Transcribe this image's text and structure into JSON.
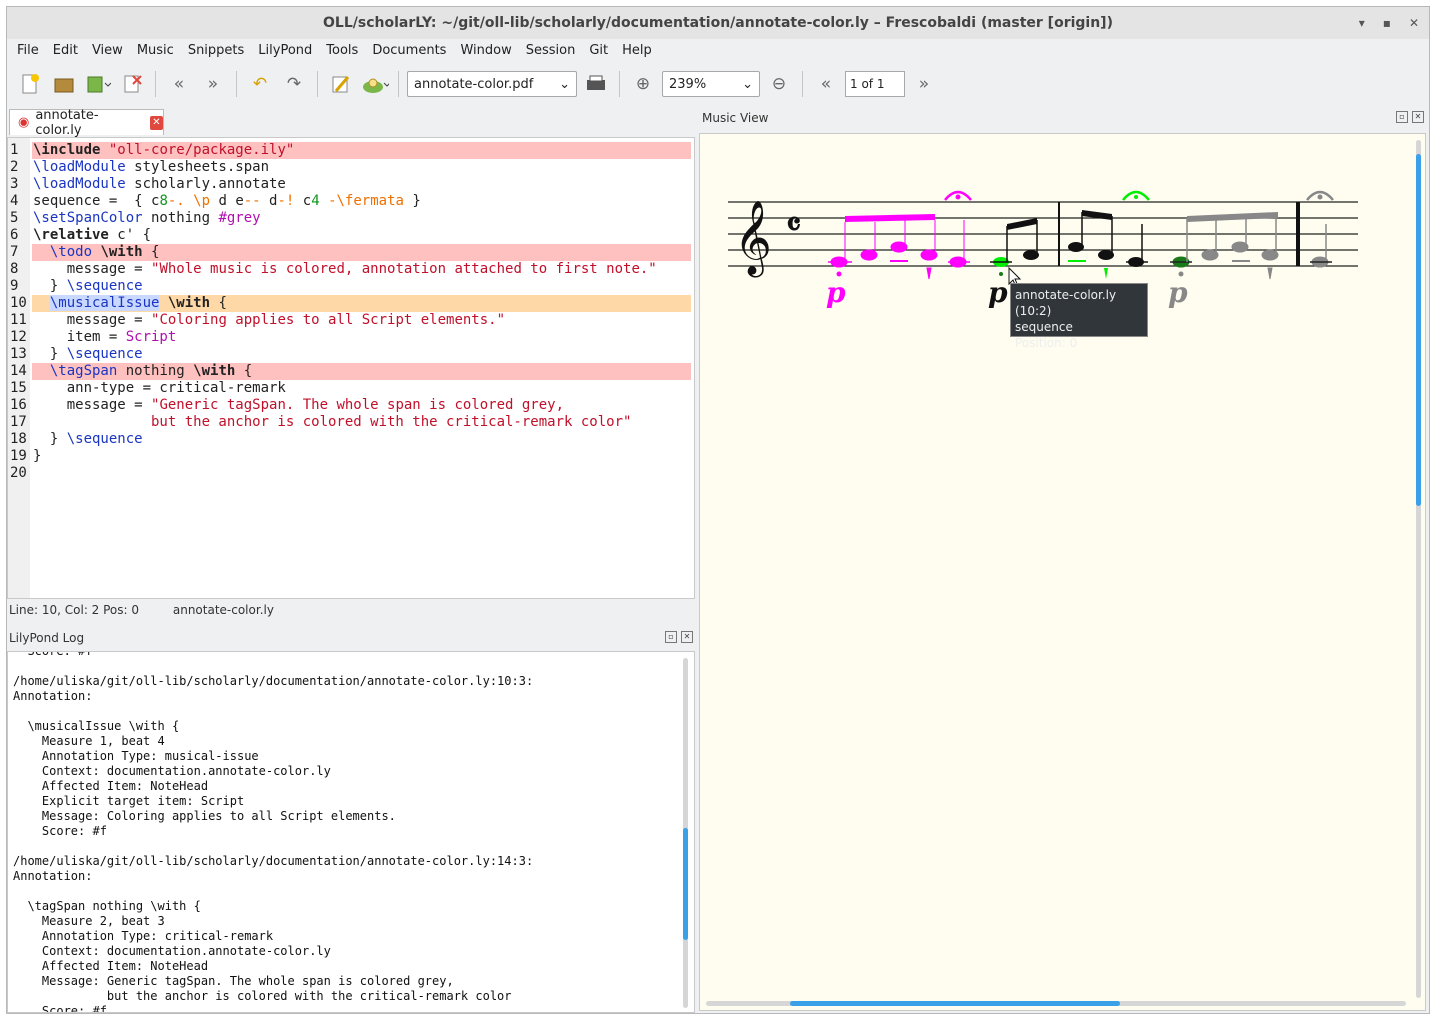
{
  "window": {
    "title": "OLL/scholarLY: ~/git/oll-lib/scholarly/documentation/annotate-color.ly – Frescobaldi (master [origin])",
    "controls": [
      "▾",
      "▪",
      "✕"
    ]
  },
  "menu": [
    "File",
    "Edit",
    "View",
    "Music",
    "Snippets",
    "LilyPond",
    "Tools",
    "Documents",
    "Window",
    "Session",
    "Git",
    "Help"
  ],
  "toolbar": {
    "document_combo": "annotate-color.pdf",
    "zoom_combo": "239%",
    "page_field": "1 of 1"
  },
  "editor": {
    "tab_label": "annotate-color.ly",
    "status": {
      "position": "Line: 10, Col: 2  Pos: 0",
      "file": "annotate-color.ly"
    },
    "line_numbers": [
      "1",
      "2",
      "3",
      "4",
      "5",
      "6",
      "7",
      "8",
      "9",
      "10",
      "11",
      "12",
      "13",
      "14",
      "15",
      "16",
      "17",
      "18",
      "19",
      "20"
    ]
  },
  "log": {
    "title": "LilyPond Log",
    "lines": [
      "  Score: #f",
      "",
      "/home/uliska/git/oll-lib/scholarly/documentation/annotate-color.ly:10:3:",
      "Annotation:",
      "",
      "  \\musicalIssue \\with {",
      "    Measure 1, beat 4",
      "    Annotation Type: musical-issue",
      "    Context: documentation.annotate-color.ly",
      "    Affected Item: NoteHead",
      "    Explicit target item: Script",
      "    Message: Coloring applies to all Script elements.",
      "    Score: #f",
      "",
      "/home/uliska/git/oll-lib/scholarly/documentation/annotate-color.ly:14:3:",
      "Annotation:",
      "",
      "  \\tagSpan nothing \\with {",
      "    Measure 2, beat 3",
      "    Annotation Type: critical-remark",
      "    Context: documentation.annotate-color.ly",
      "    Affected Item: NoteHead",
      "    Message: Generic tagSpan. The whole span is colored grey,",
      "             but the anchor is colored with the critical-remark color",
      "    Score: #f"
    ]
  },
  "music_view": {
    "title": "Music View",
    "tooltip": {
      "line1": "annotate-color.ly (10:2)",
      "line2": "sequence",
      "line3": "Position: 0"
    },
    "dynamic_marking": "p"
  },
  "colors": {
    "magenta": "#ff00ff",
    "green": "#00ee00",
    "dark_green": "#1a7a1a",
    "grey": "#888888",
    "scrollbar": "#3aa0e8"
  }
}
